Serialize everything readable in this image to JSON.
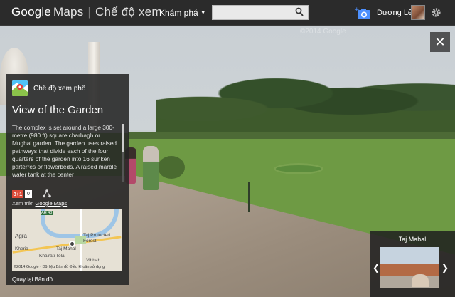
{
  "header": {
    "logo_google": "Google",
    "logo_maps": "Maps",
    "logo_divider": "|",
    "logo_mode": "Chế độ xem",
    "explore_label": "Khám phá",
    "search_placeholder": "",
    "username": "Dương Lê"
  },
  "scene": {
    "watermark": "©2014 Google"
  },
  "panel": {
    "place_label": "Chế độ xem phố",
    "title": "View of the Garden",
    "description": "The complex is set around a large 300-metre (980 ft) square charbagh or Mughal garden. The garden uses raised pathways that divide each of the four quarters of the garden into 16 sunken parterres or flowerbeds. A raised marble water tank at the center",
    "gplus_label": "8+1",
    "gplus_count": "0",
    "view_on_prefix": "Xem trên ",
    "view_on_link": "Google Maps",
    "back_to_map": "Quay lại Bản đồ"
  },
  "map": {
    "labels": {
      "agra": "Agra",
      "taj_mahal": "Taj Mahal",
      "taj_forest": "Taj Protected Forest",
      "kheria": "Kheria",
      "khairati_tola": "Khairati Tola",
      "vibhab": "Vibhab",
      "ah_badge": "AH 43"
    },
    "copyright": "©2014 Google · Dữ liệu Bản đồ    Điều khoản sử dụng"
  },
  "thumbnail": {
    "title": "Taj Mahal"
  },
  "icons": {
    "search": "search-icon",
    "add_photo": "camera-plus-icon",
    "settings": "gear-icon",
    "close": "close-icon",
    "share": "share-icon",
    "place": "pegman-place-icon"
  }
}
